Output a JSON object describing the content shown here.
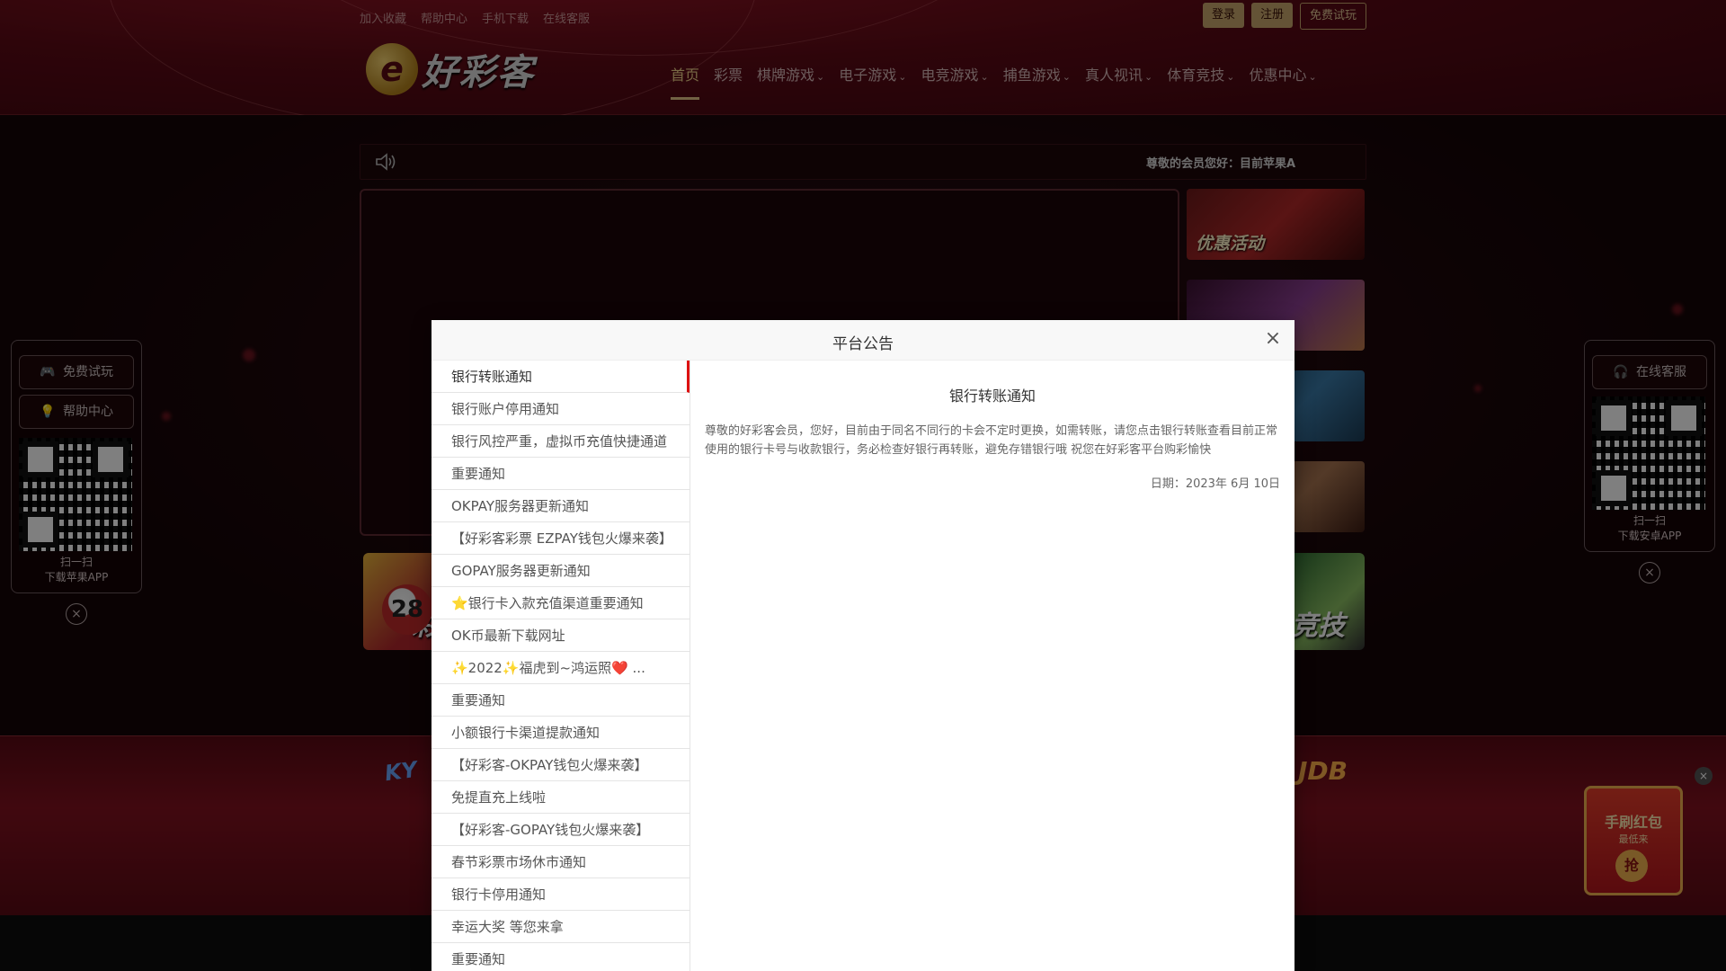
{
  "topbar": {
    "links": [
      "加入收藏",
      "帮助中心",
      "手机下载",
      "在线客服"
    ],
    "login": "登录",
    "register": "注册",
    "trial": "免费试玩"
  },
  "logo": {
    "mark": "e",
    "text": "好彩客"
  },
  "nav": {
    "items": [
      {
        "label": "首页",
        "dropdown": false,
        "active": true
      },
      {
        "label": "彩票",
        "dropdown": false
      },
      {
        "label": "棋牌游戏",
        "dropdown": true
      },
      {
        "label": "电子游戏",
        "dropdown": true
      },
      {
        "label": "电竞游戏",
        "dropdown": true
      },
      {
        "label": "捕鱼游戏",
        "dropdown": true
      },
      {
        "label": "真人视讯",
        "dropdown": true
      },
      {
        "label": "体育竞技",
        "dropdown": true
      },
      {
        "label": "优惠中心",
        "dropdown": true
      }
    ]
  },
  "notice_bar": {
    "text": "尊敬的会员您好：目前苹果A"
  },
  "tiles": {
    "promo": "优惠活动",
    "lottery_ball": "28",
    "lottery_text": "彩",
    "sports_text": "竞技"
  },
  "left_panel": {
    "trial": "免费试玩",
    "help": "帮助中心",
    "scan": "扫一扫",
    "download": "下载苹果APP"
  },
  "right_panel": {
    "service": "在线客服",
    "scan": "扫一扫",
    "download": "下载安卓APP"
  },
  "footer_brands": {
    "ky": "KY",
    "jdb": "JDB"
  },
  "redpack": {
    "title": "手刷红包",
    "sub": "最低来",
    "grab": "抢"
  },
  "modal": {
    "title": "平台公告",
    "close": "×",
    "list": [
      "银行转账通知",
      "银行账户停用通知",
      "银行风控严重，虚拟币充值快捷通道",
      "重要通知",
      "OKPAY服务器更新通知",
      "【好彩客彩票 EZPAY钱包火爆来袭】",
      "GOPAY服务器更新通知",
      "⭐银行卡入款充值渠道重要通知",
      "OK币最新下载网址",
      "✨2022✨福虎到~鸿运照❤️ ...",
      "重要通知",
      "小额银行卡渠道提款通知",
      "【好彩客-OKPAY钱包火爆来袭】",
      "免提直充上线啦",
      "【好彩客-GOPAY钱包火爆来袭】",
      "春节彩票市场休市通知",
      "银行卡停用通知",
      "幸运大奖 等您来拿",
      "重要通知"
    ],
    "detail": {
      "title": "银行转账通知",
      "body": "尊敬的好彩客会员，您好，目前由于同名不同行的卡会不定时更换，如需转账，请您点击银行转账查看目前正常使用的银行卡号与收款银行，务必检查好银行再转账，避免存错银行哦 祝您在好彩客平台购彩愉快",
      "date": "日期：2023年 6月 10日"
    }
  }
}
